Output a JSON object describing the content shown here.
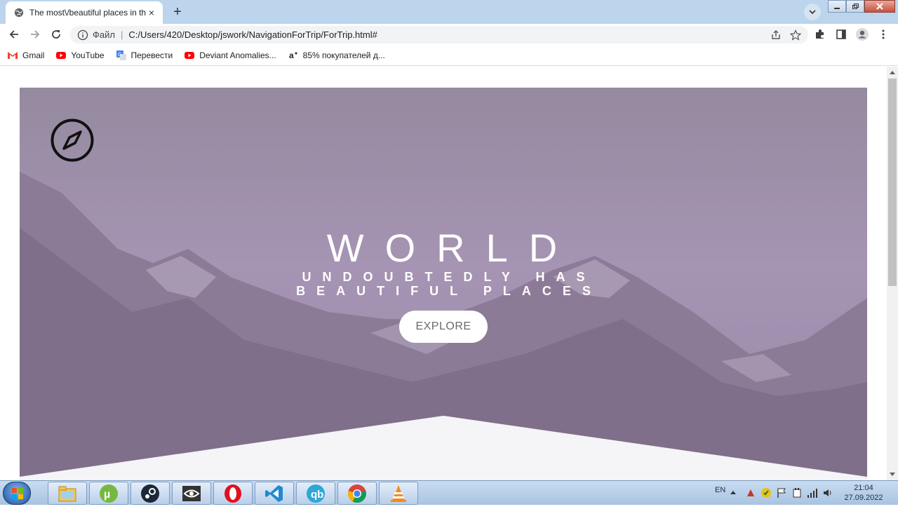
{
  "browser": {
    "tab_title": "The most\\/beautiful places in the",
    "tab_close": "×",
    "new_tab": "+",
    "omnibox": {
      "protocol_label": "Файл",
      "separator": "|",
      "url": "C:/Users/420/Desktop/jswork/NavigationForTrip/ForTrip.html#"
    },
    "bookmarks": [
      {
        "label": "Gmail",
        "icon": "gmail-icon"
      },
      {
        "label": "YouTube",
        "icon": "youtube-icon"
      },
      {
        "label": "Перевести",
        "icon": "translate-icon"
      },
      {
        "label": "Deviant Anomalies...",
        "icon": "youtube-icon"
      },
      {
        "label": "85% покупателей д...",
        "icon": "aliexpress-icon"
      }
    ]
  },
  "page": {
    "headline": "WORLD",
    "subtitle_line1": "UNDOUBTEDLY HAS",
    "subtitle_line2": "BEAUTIFUL PLACES",
    "explore_button": "EXPLORE",
    "logo_icon": "compass-icon"
  },
  "taskbar": {
    "apps": [
      "file-explorer-icon",
      "utorrent-icon",
      "steam-icon",
      "eye-app-icon",
      "opera-icon",
      "vscode-icon",
      "qbittorrent-icon",
      "chrome-icon",
      "vlc-icon"
    ],
    "language": "EN",
    "time": "21:04",
    "date": "27.09.2022"
  },
  "colors": {
    "hero_overlay": "#a392b2",
    "tabstrip": "#bcd4ec"
  }
}
